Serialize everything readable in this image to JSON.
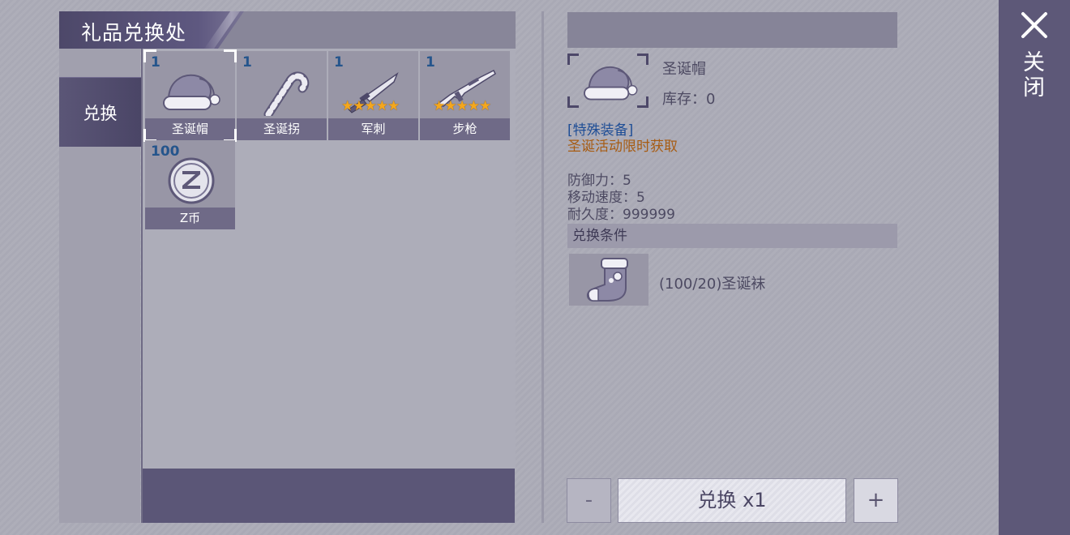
{
  "header": {
    "title": "礼品兑换处"
  },
  "tabs": [
    {
      "label": "兑换",
      "active": true
    }
  ],
  "items": [
    {
      "count": "1",
      "name": "圣诞帽",
      "icon": "santa-hat-icon",
      "stars": ""
    },
    {
      "count": "1",
      "name": "圣诞拐",
      "icon": "candy-cane-icon",
      "stars": ""
    },
    {
      "count": "1",
      "name": "军刺",
      "icon": "bayonet-icon",
      "stars": "★★★★★"
    },
    {
      "count": "1",
      "name": "步枪",
      "icon": "rifle-icon",
      "stars": "★★★★★"
    },
    {
      "count": "100",
      "name": "Z币",
      "icon": "z-coin-icon",
      "stars": ""
    }
  ],
  "selected_index": 0,
  "detail": {
    "name": "圣诞帽",
    "stock": "库存：0",
    "category": "[特殊装备]",
    "source": "圣诞活动限时获取",
    "stats": [
      "防御力：5",
      "移动速度：5",
      "耐久度：999999"
    ],
    "condition_header": "兑换条件",
    "condition_text": "(100/20)圣诞袜",
    "condition_icon": "christmas-stocking-icon"
  },
  "actions": {
    "minus": "-",
    "exchange": "兑换 x1",
    "plus": "+"
  },
  "close": {
    "label": "关闭",
    "icon": "close-icon"
  },
  "colors": {
    "accent_purple": "#5b5677",
    "count_blue": "#25558c",
    "category_blue": "#1f4e96",
    "source_orange": "#a75c13",
    "star_gold": "#f4a71d"
  }
}
